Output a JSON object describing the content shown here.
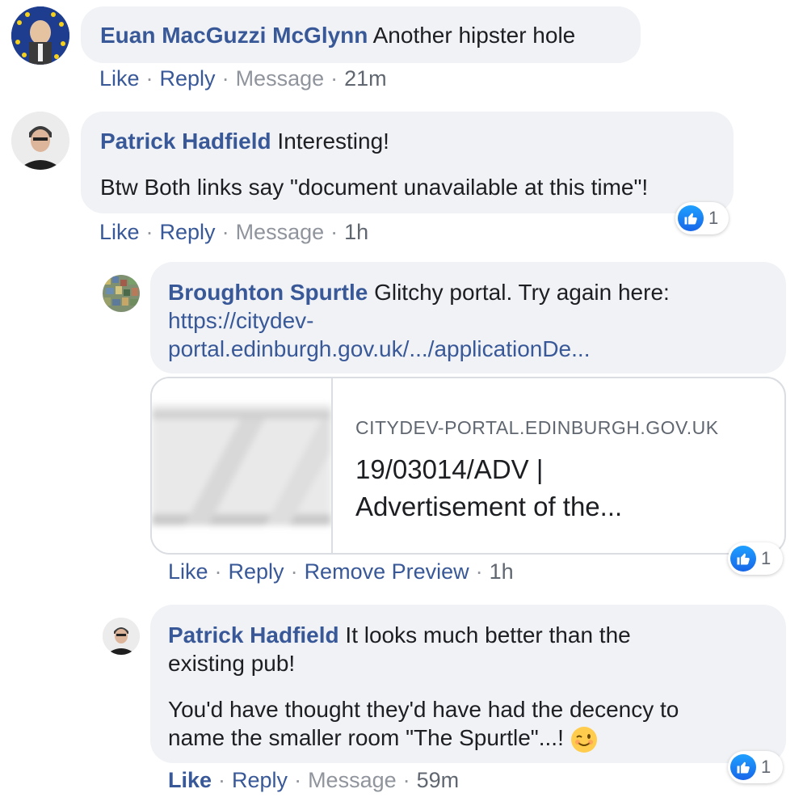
{
  "comments": [
    {
      "author": "Euan MacGuzzi McGlynn",
      "text": "Another hipster hole",
      "actions": {
        "like": "Like",
        "reply": "Reply",
        "message": "Message",
        "time": "21m"
      }
    },
    {
      "author": "Patrick Hadfield",
      "text_line1": "Interesting!",
      "text_line2": "Btw Both links say \"document unavailable at this time\"!",
      "actions": {
        "like": "Like",
        "reply": "Reply",
        "message": "Message",
        "time": "1h"
      },
      "reactions": {
        "count": "1"
      },
      "replies": [
        {
          "author": "Broughton Spurtle",
          "text": "Glitchy portal. Try again here:",
          "link_line1": "https://citydev-",
          "link_line2": "portal.edinburgh.gov.uk/.../applicationDe...",
          "preview": {
            "domain": "CITYDEV-PORTAL.EDINBURGH.GOV.UK",
            "title_line1": "19/03014/ADV |",
            "title_line2": "Advertisement of the..."
          },
          "actions": {
            "like": "Like",
            "reply": "Reply",
            "remove_preview": "Remove Preview",
            "time": "1h"
          },
          "reactions": {
            "count": "1"
          }
        },
        {
          "author": "Patrick Hadfield",
          "text_line1": "It looks much better than the",
          "text_line2": "existing pub!",
          "text_line3": "You'd have thought they'd have had the decency to",
          "text_line4": "name the smaller room \"The Spurtle\"...!",
          "actions": {
            "like": "Like",
            "reply": "Reply",
            "message": "Message",
            "time": "59m"
          },
          "reactions": {
            "count": "1"
          }
        }
      ]
    }
  ],
  "colors": {
    "link_blue": "#385898",
    "bubble_bg": "#f0f2f5",
    "meta_gray": "#90949c",
    "like_blue": "#1877f2"
  }
}
